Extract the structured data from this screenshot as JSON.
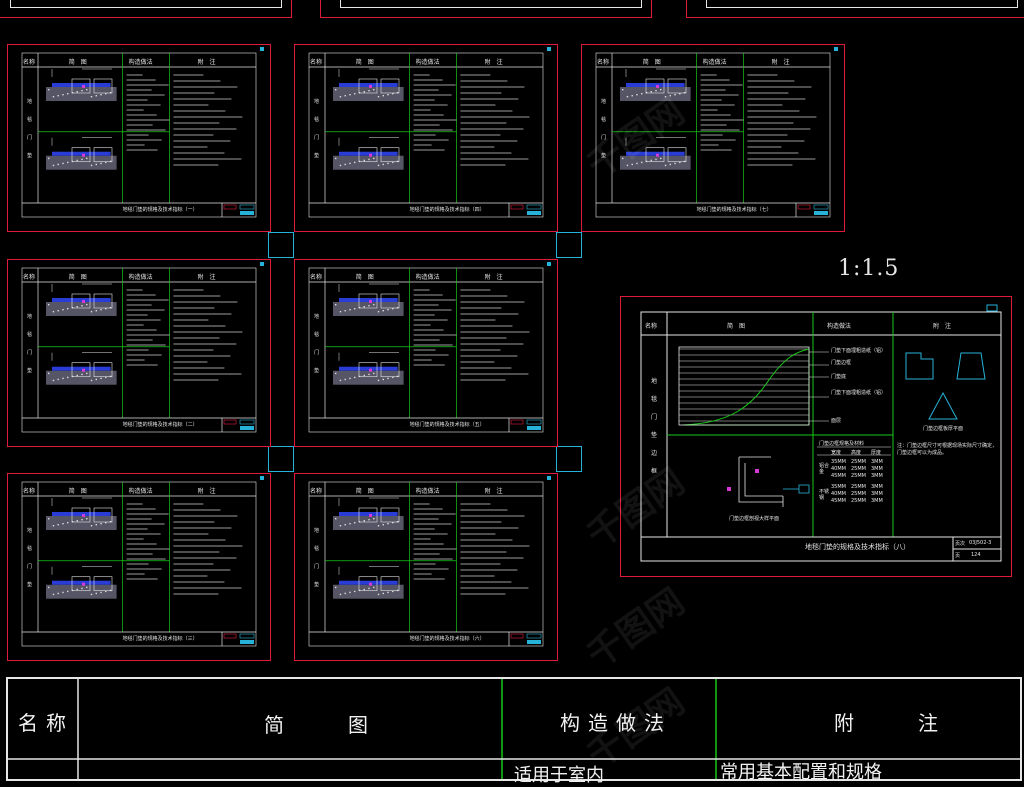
{
  "scale_label": "1:1.5",
  "headers": {
    "name": "名称",
    "sketch": "简　图",
    "method": "构造做法",
    "notes": "附　注"
  },
  "bottom_headers": {
    "name": "名称",
    "sketch": "简　　图",
    "method": "构造做法",
    "notes": "附　　注",
    "method_row": "适用于室内",
    "notes_row": "常用基本配置和规格"
  },
  "side_label": "地毯门垫",
  "sheets": [
    {
      "caption": "地毯门垫的规格及技术指标（一）"
    },
    {
      "caption": "地毯门垫的规格及技术指标（四）"
    },
    {
      "caption": "地毯门垫的规格及技术指标（七）"
    },
    {
      "caption": "地毯门垫的规格及技术指标（二）"
    },
    {
      "caption": "地毯门垫的规格及技术指标（五）"
    },
    {
      "caption": "地毯门垫的规格及技术指标（三）"
    },
    {
      "caption": "地毯门垫的规格及技术指标（六）"
    }
  ],
  "detail": {
    "caption": "地毯门垫的规格及技术指标（八）",
    "side_label": "地毯门垫边框",
    "method_lines": [
      "门垫下面埋粗造纸（铝）",
      "门垫边框",
      "门垫底",
      "门垫下面埋粗造纸（铝）",
      "面层"
    ],
    "plan_caption": "门垫边框剖视大样平面",
    "notes_caption": "门垫边框板厚平面",
    "notes_text": "注：门垫边框尺寸可根据现场实际尺寸确定，门垫边框可以为成品。",
    "table_title": "门垫边框规格及材料",
    "table_head": [
      "宽度",
      "高度",
      "厚度"
    ],
    "table_rows": [
      [
        "35MM",
        "25MM",
        "3MM"
      ],
      [
        "40MM",
        "25MM",
        "3MM"
      ],
      [
        "45MM",
        "25MM",
        "3MM"
      ],
      [
        "35MM",
        "25MM",
        "3MM"
      ],
      [
        "40MM",
        "25MM",
        "3MM"
      ],
      [
        "45MM",
        "25MM",
        "3MM"
      ]
    ],
    "table_side": [
      "铝合金",
      "不锈钢"
    ],
    "page_no": "页次",
    "page_ref": "03J502-3",
    "sheet_no": "页",
    "sheet_val": "124"
  },
  "watermark": "千图网"
}
